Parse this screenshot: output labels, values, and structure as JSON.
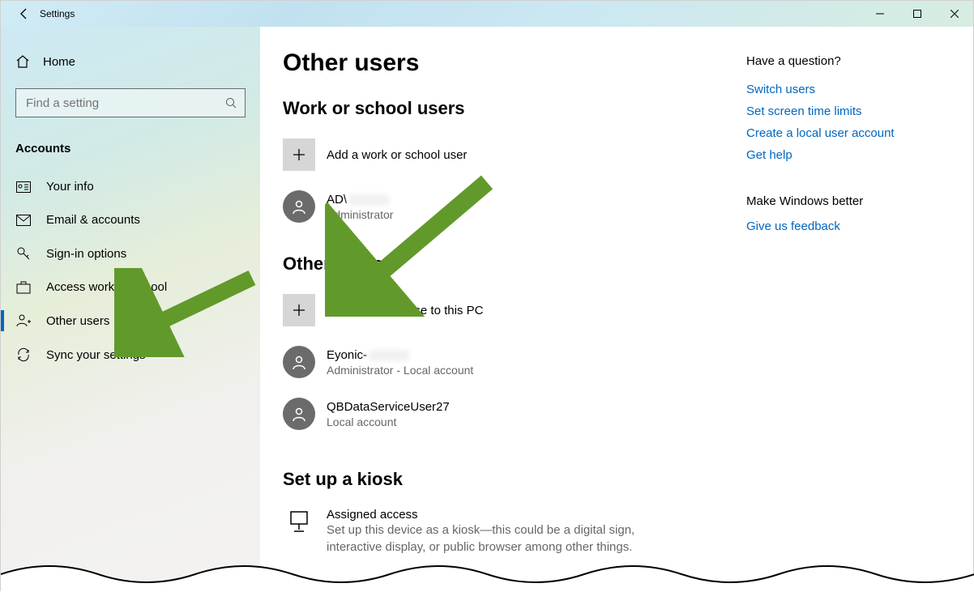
{
  "window": {
    "title": "Settings"
  },
  "sidebar": {
    "home_label": "Home",
    "search_placeholder": "Find a setting",
    "category": "Accounts",
    "items": [
      {
        "label": "Your info"
      },
      {
        "label": "Email & accounts"
      },
      {
        "label": "Sign-in options"
      },
      {
        "label": "Access work or school"
      },
      {
        "label": "Other users"
      },
      {
        "label": "Sync your settings"
      }
    ]
  },
  "page": {
    "title": "Other users",
    "section_work": "Work or school users",
    "add_work_label": "Add a work or school user",
    "work_user_name": "AD\\",
    "work_user_role": "Administrator",
    "section_other": "Other users",
    "add_other_label": "Add someone else to this PC",
    "other_users": [
      {
        "name": "Eyonic-",
        "role": "Administrator - Local account"
      },
      {
        "name": "QBDataServiceUser27",
        "role": "Local account"
      }
    ],
    "section_kiosk": "Set up a kiosk",
    "kiosk_title": "Assigned access",
    "kiosk_desc": "Set up this device as a kiosk—this could be a digital sign, interactive display, or public browser among other things."
  },
  "right": {
    "question": "Have a question?",
    "links": [
      "Switch users",
      "Set screen time limits",
      "Create a local user account",
      "Get help"
    ],
    "better": "Make Windows better",
    "feedback": "Give us feedback"
  }
}
